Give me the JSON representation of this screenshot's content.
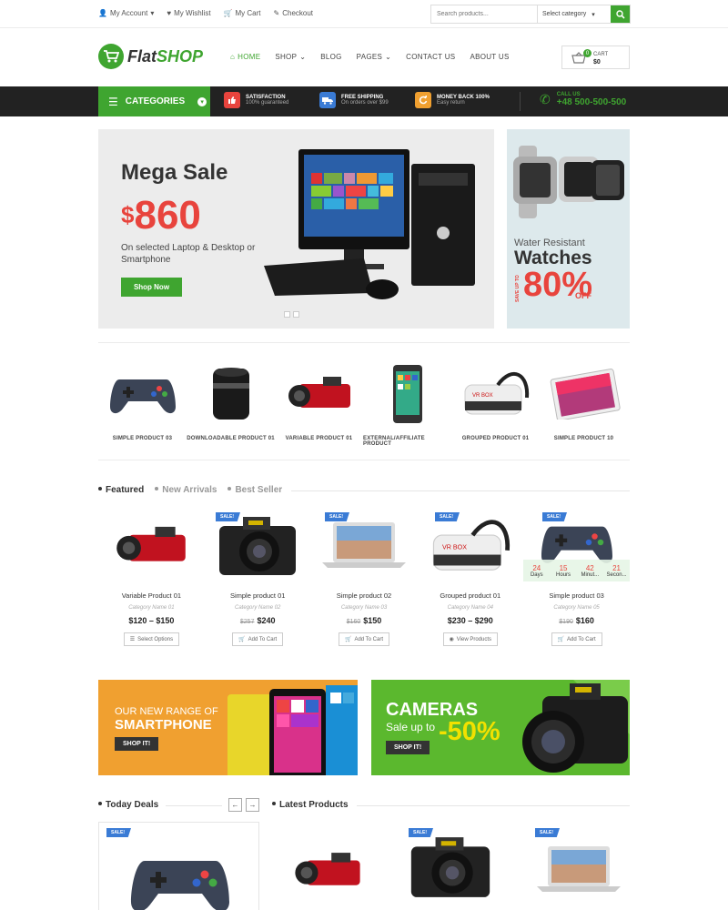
{
  "topbar": {
    "links": [
      "My Account",
      "My Wishlist",
      "My Cart",
      "Checkout"
    ],
    "search_placeholder": "Search products...",
    "category_select": "Select category"
  },
  "header": {
    "logo_flat": "Flat",
    "logo_shop": "SHOP",
    "nav": [
      "HOME",
      "SHOP",
      "BLOG",
      "PAGES",
      "CONTACT US",
      "ABOUT US"
    ],
    "cart_label": "CART",
    "cart_amount": "$0",
    "cart_count": "0"
  },
  "bar": {
    "categories": "CATEGORIES",
    "features": [
      {
        "title": "SATISFACTION",
        "sub": "100% guaranteed",
        "color": "#e8443d"
      },
      {
        "title": "FREE SHIPPING",
        "sub": "On orders over $99",
        "color": "#3a7bd5"
      },
      {
        "title": "MONEY BACK 100%",
        "sub": "Easy return",
        "color": "#f0a030"
      }
    ],
    "call_label": "CALL US",
    "phone": "+48 500-500-500"
  },
  "hero": {
    "title": "Mega Sale",
    "currency": "$",
    "price": "860",
    "subtitle": "On selected Laptop & Desktop or Smartphone",
    "button": "Shop Now",
    "side_line1": "Water Resistant",
    "side_line2": "Watches",
    "side_saveup": "SAVE UP TO",
    "side_percent": "80%",
    "side_off": "OFF"
  },
  "strip": [
    "SIMPLE PRODUCT 03",
    "DOWNLOADABLE PRODUCT 01",
    "VARIABLE PRODUCT 01",
    "EXTERNAL/AFFILIATE PRODUCT",
    "GROUPED PRODUCT 01",
    "SIMPLE PRODUCT 10"
  ],
  "tabs": [
    "Featured",
    "New Arrivals",
    "Best Seller"
  ],
  "products": [
    {
      "name": "Variable Product 01",
      "cat": "Category Name 01",
      "old": "",
      "price": "$120 – $150",
      "btn": "Select Options",
      "sale": ""
    },
    {
      "name": "Simple product 01",
      "cat": "Category Name 02",
      "old": "$257",
      "price": "$240",
      "btn": "Add To Cart",
      "sale": "SALE!"
    },
    {
      "name": "Simple product 02",
      "cat": "Category Name 03",
      "old": "$160",
      "price": "$150",
      "btn": "Add To Cart",
      "sale": "SALE!"
    },
    {
      "name": "Grouped product 01",
      "cat": "Category Name 04",
      "old": "",
      "price": "$230 – $290",
      "btn": "View Products",
      "sale": "SALE!"
    },
    {
      "name": "Simple product 03",
      "cat": "Category Name 05",
      "old": "$190",
      "price": "$160",
      "btn": "Add To Cart",
      "sale": "SALE!"
    }
  ],
  "countdown": [
    {
      "n": "24",
      "l": "Days"
    },
    {
      "n": "15",
      "l": "Hours"
    },
    {
      "n": "42",
      "l": "Minut..."
    },
    {
      "n": "21",
      "l": "Secon..."
    }
  ],
  "banners": {
    "b1_line1": "OUR NEW RANGE OF",
    "b1_line2": "SMARTPHONE",
    "b1_btn": "SHOP IT!",
    "b2_line1": "CAMERAS",
    "b2_line2": "Sale up to",
    "b2_percent": "-50%",
    "b2_btn": "SHOP IT!"
  },
  "bottom": {
    "today": "Today Deals",
    "latest": "Latest Products",
    "sale": "SALE!"
  }
}
